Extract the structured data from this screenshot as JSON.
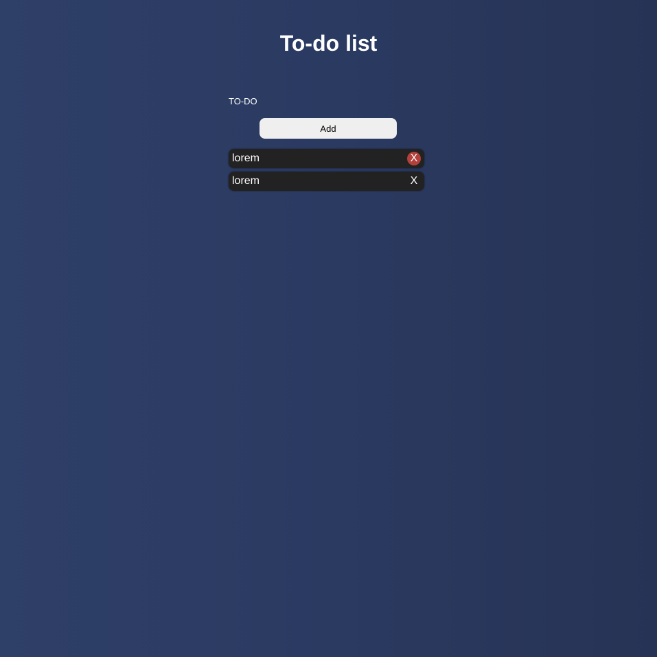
{
  "header": {
    "title": "To-do list"
  },
  "form": {
    "label": "TO-DO",
    "add_label": "Add"
  },
  "todos": [
    {
      "text": "lorem",
      "delete_label": "X",
      "hovered": true
    },
    {
      "text": "lorem",
      "delete_label": "X",
      "hovered": false
    }
  ],
  "colors": {
    "background_start": "#2e3f68",
    "background_end": "#273355",
    "item_background": "#222222",
    "delete_hover": "#b3403b",
    "button_background": "#efefef"
  }
}
